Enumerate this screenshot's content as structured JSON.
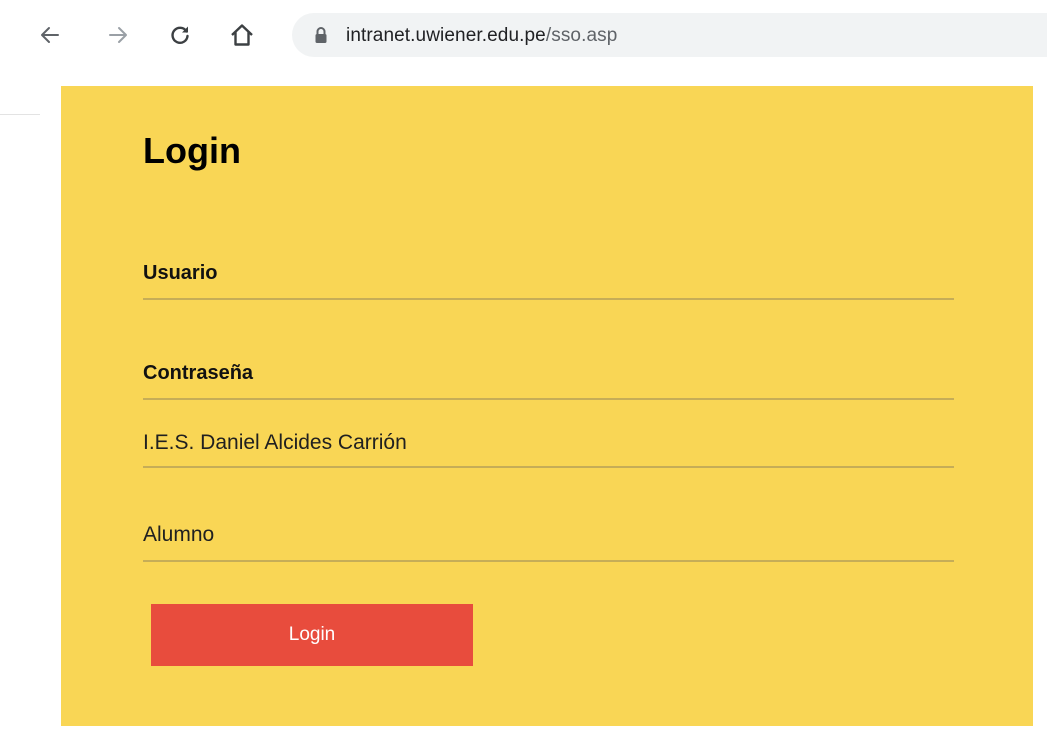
{
  "browser": {
    "url_host": "intranet.uwiener.edu.pe",
    "url_path": "/sso.asp"
  },
  "form": {
    "title": "Login",
    "usuario_label": "Usuario",
    "contrasena_label": "Contraseña",
    "institution_value": "I.E.S. Daniel Alcides Carrión",
    "role_value": "Alumno",
    "submit_label": "Login"
  },
  "colors": {
    "card_background": "#f9d655",
    "button_background": "#e84c3d",
    "field_underline": "#c6ad57"
  }
}
